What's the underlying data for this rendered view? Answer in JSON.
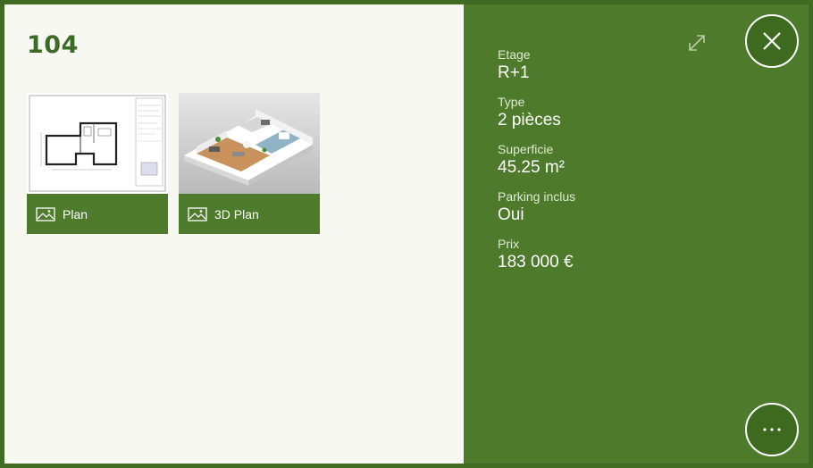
{
  "unit": {
    "title": "104"
  },
  "gallery": [
    {
      "label": "Plan",
      "icon": "image-icon"
    },
    {
      "label": "3D Plan",
      "icon": "image-icon"
    }
  ],
  "details": [
    {
      "label": "Etage",
      "value": "R+1"
    },
    {
      "label": "Type",
      "value": "2 pièces"
    },
    {
      "label": "Superficie",
      "value": "45.25 m²"
    },
    {
      "label": "Parking inclus",
      "value": "Oui"
    },
    {
      "label": "Prix",
      "value": "183 000 €"
    }
  ],
  "controls": {
    "expand_icon": "expand-arrows-icon",
    "close_icon": "close-icon",
    "more_icon": "more-dots-icon"
  },
  "colors": {
    "accent": "#4e7a2b",
    "title": "#3c6b25",
    "panel_light": "#f6f8f1"
  }
}
